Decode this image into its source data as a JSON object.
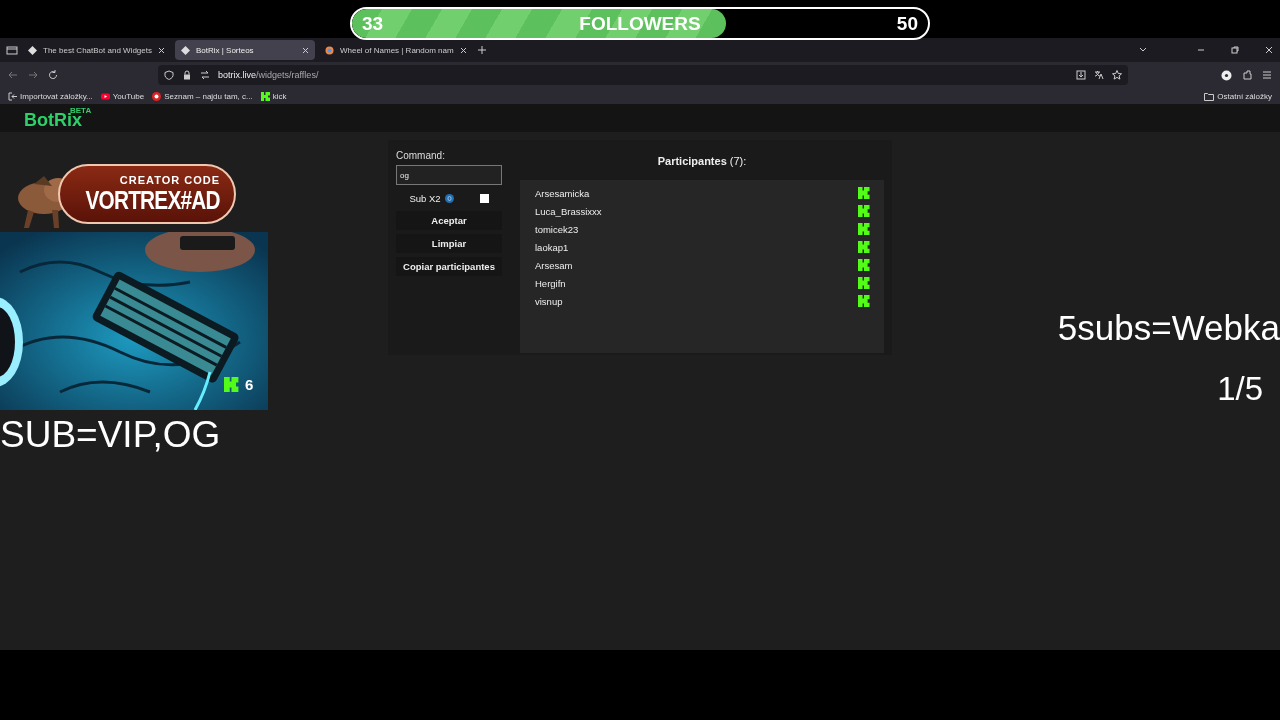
{
  "followers_goal": {
    "current": "33",
    "label": "FOLLOWERS",
    "target": "50",
    "level": 0.65
  },
  "browser": {
    "tabs": [
      {
        "title": "The best ChatBot and Widgets",
        "selected": false
      },
      {
        "title": "BotRix | Sorteos",
        "selected": true
      },
      {
        "title": "Wheel of Names | Random nam",
        "selected": false
      }
    ],
    "address": {
      "domain": "botrix.live",
      "path": "/widgets/raffles/"
    },
    "bookmarks": [
      {
        "label": "Importovat záložky...",
        "kind": "import"
      },
      {
        "label": "YouTube",
        "kind": "play"
      },
      {
        "label": "Seznam – najdu tam, c...",
        "kind": "s-logo"
      },
      {
        "label": "kick",
        "kind": "k-logo"
      }
    ],
    "other_bookmarks": "Ostatní záložky"
  },
  "page": {
    "logo": "BotRix",
    "logo_badge": "BETA",
    "command_label": "Command:",
    "command_value": "og",
    "sub_x2": {
      "label": "Sub X2",
      "checked": false
    },
    "buttons": [
      "Aceptar",
      "Limpiar",
      "Copiar participantes"
    ],
    "participants_title": "Participantes",
    "participants_count": "(7):",
    "participants": [
      "Arsesamicka",
      "Luca_Brassixxx",
      "tomicek23",
      "laokap1",
      "Arsesam",
      "Hergifn",
      "visnup"
    ]
  },
  "overlays": {
    "creator_code": {
      "title": "CREATOR CODE",
      "code": "VORTREX#AD"
    },
    "kick_count": "6",
    "sub_reward": "SUB=VIP,OG",
    "sub_goal": "5subs=Webka",
    "sub_progress": "1/5"
  }
}
